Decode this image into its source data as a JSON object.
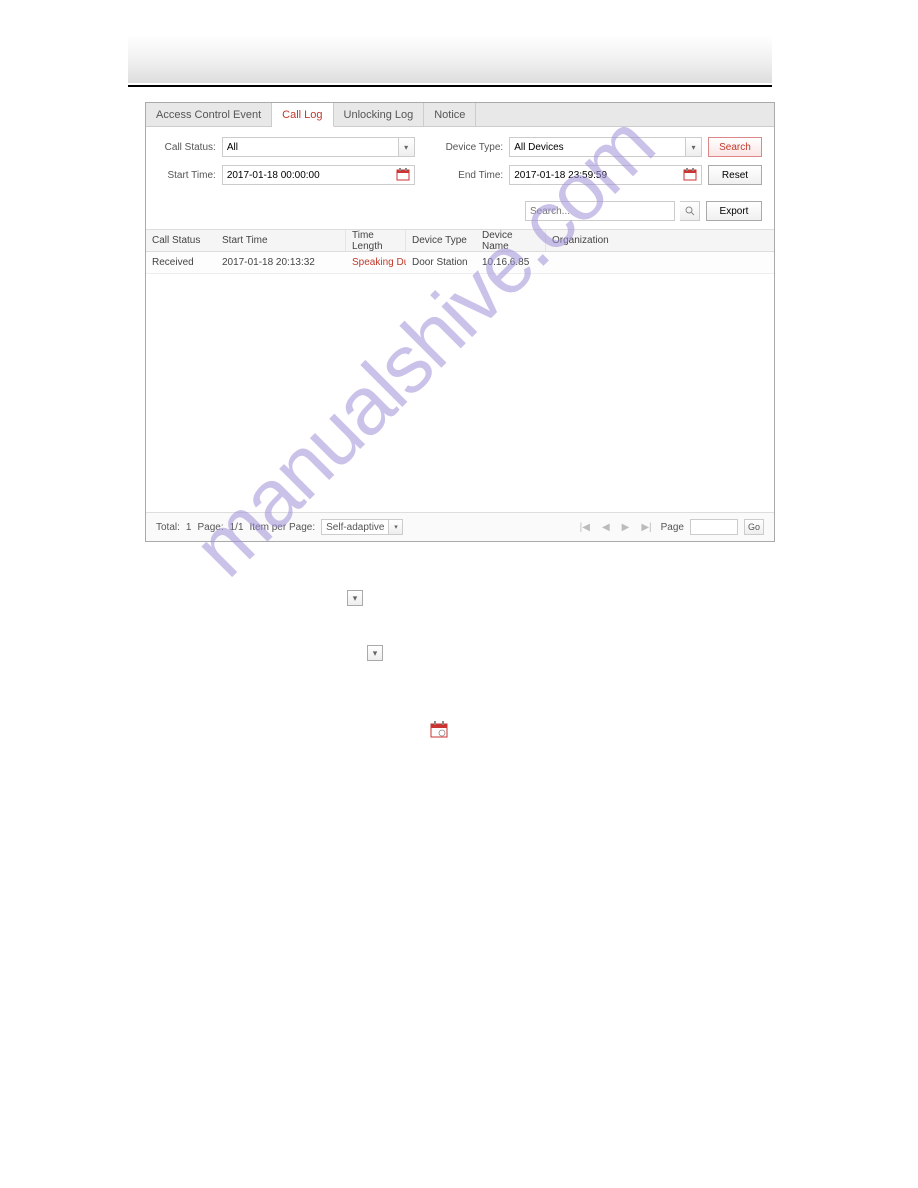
{
  "tabs": {
    "access_control_event": "Access Control Event",
    "call_log": "Call Log",
    "unlocking_log": "Unlocking Log",
    "notice": "Notice"
  },
  "filters": {
    "call_status_label": "Call Status:",
    "call_status_value": "All",
    "device_type_label": "Device Type:",
    "device_type_value": "All Devices",
    "start_time_label": "Start Time:",
    "start_time_value": "2017-01-18 00:00:00",
    "end_time_label": "End Time:",
    "end_time_value": "2017-01-18 23:59:59",
    "search_btn": "Search",
    "reset_btn": "Reset",
    "search_placeholder": "Search...",
    "export_btn": "Export"
  },
  "table": {
    "headers": {
      "call_status": "Call Status",
      "start_time": "Start Time",
      "time_length": "Time Length",
      "device_type": "Device Type",
      "device_name": "Device Name",
      "organization": "Organization"
    },
    "rows": [
      {
        "call_status": "Received",
        "start_time": "2017-01-18 20:13:32",
        "time_length": "Speaking Durati...",
        "device_type": "Door Station",
        "device_name": "10.16.6.85",
        "organization": ""
      }
    ]
  },
  "footer": {
    "total_label": "Total:",
    "total_value": "1",
    "page_label": "Page:",
    "page_value": "1/1",
    "item_per_page_label": "Item per Page:",
    "item_per_page_value": "Self-adaptive",
    "page_nav_label": "Page",
    "go_btn": "Go"
  },
  "watermark": "manualshive.com"
}
